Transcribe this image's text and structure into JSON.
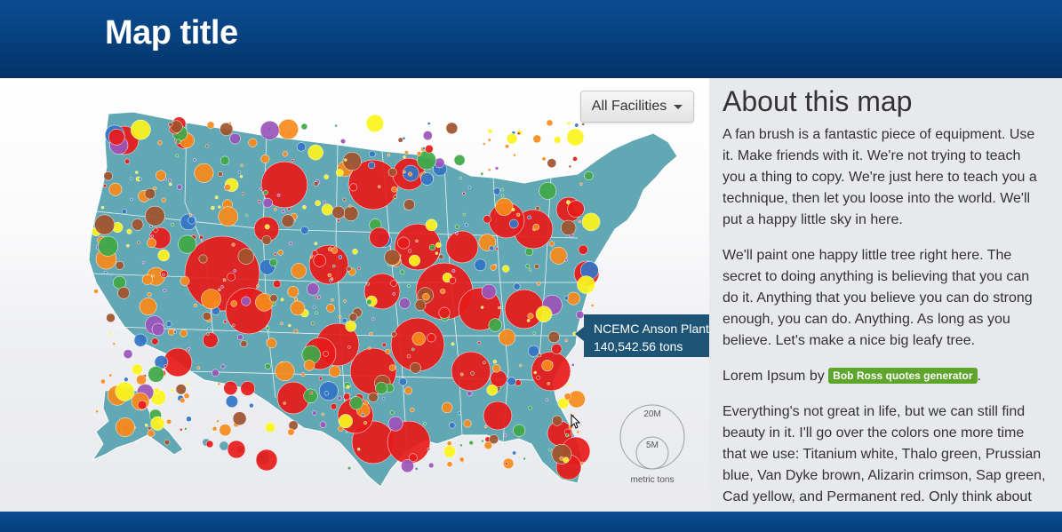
{
  "header": {
    "title": "Map title"
  },
  "map": {
    "filter": {
      "selected": "All Facilities"
    },
    "tooltip": {
      "facility": "NCEMC Anson Plant",
      "value": "140,542.56 tons"
    },
    "legend": {
      "sizes": [
        {
          "label": "20M"
        },
        {
          "label": "5M"
        }
      ],
      "unit": "metric tons"
    },
    "colors": {
      "land": "#62a8b4",
      "red": "#e81a1a",
      "yellow": "#fbf41c",
      "orange": "#f78a1b",
      "purple": "#9a55b9",
      "blue": "#3274c4",
      "brown": "#a0522d",
      "green": "#3ea845"
    }
  },
  "about": {
    "title": "About this map",
    "p1": "A fan brush is a fantastic piece of equipment. Use it. Make friends with it. We're not trying to teach you a thing to copy. We're just here to teach you a technique, then let you loose into the world. We'll put a happy little sky in here.",
    "p2": "We'll paint one happy little tree right here. The secret to doing anything is believing that you can do it. Anything that you believe you can do strong enough, you can do. Anything. As long as you believe. Let's make a nice big leafy tree.",
    "credit_prefix": "Lorem Ipsum by",
    "credit_link": "Bob Ross quotes generator",
    "credit_suffix": ".",
    "p4": "Everything's not great in life, but we can still find beauty in it. I'll go over the colors one more time that we use: Titanium white, Thalo green, Prussian blue, Van Dyke brown, Alizarin crimson, Sap green, Cad yellow, and Permanent red. Only think about"
  }
}
